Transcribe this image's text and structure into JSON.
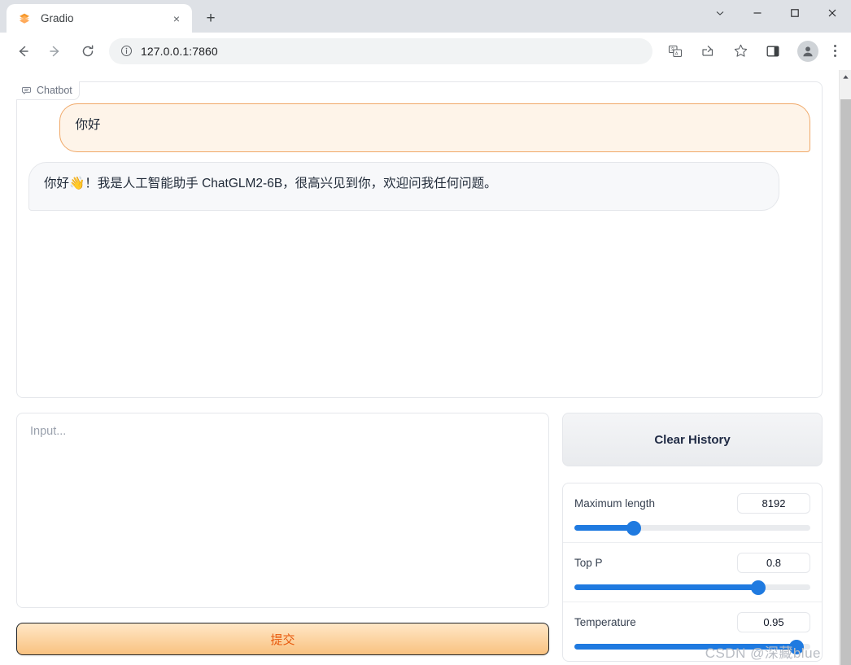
{
  "browser": {
    "tab": {
      "title": "Gradio",
      "favicon": "gradio-logo-icon",
      "close": "×"
    },
    "new_tab_label": "+",
    "window_controls": {
      "chevron": "⌄",
      "minimize": "—",
      "maximize": "▢",
      "close": "✕"
    },
    "nav": {
      "back": "←",
      "forward": "→",
      "reload": "⟳"
    },
    "omnibox": {
      "url": "127.0.0.1:7860",
      "security_icon": "info-circle-icon"
    },
    "actions": [
      "translate-icon",
      "share-icon",
      "bookmark-star-icon",
      "side-panel-icon",
      "profile-avatar",
      "more-menu-icon"
    ]
  },
  "app": {
    "chatbot": {
      "label": "Chatbot",
      "messages": [
        {
          "role": "user",
          "text": "你好"
        },
        {
          "role": "bot",
          "text": "你好👋！我是人工智能助手 ChatGLM2-6B，很高兴见到你，欢迎问我任何问题。"
        }
      ]
    },
    "input": {
      "value": "",
      "placeholder": "Input..."
    },
    "submit_label": "提交",
    "clear_label": "Clear History",
    "sliders": [
      {
        "label": "Maximum length",
        "value": "8192",
        "percent": 25
      },
      {
        "label": "Top P",
        "value": "0.8",
        "percent": 78
      },
      {
        "label": "Temperature",
        "value": "0.95",
        "percent": 94
      }
    ]
  },
  "watermark": "CSDN @深藏blue",
  "colors": {
    "accent_orange": "#f0a868",
    "submit_text": "#e8590c",
    "slider_blue": "#1f7ae0",
    "chrome_tabstrip": "#dee1e6"
  }
}
